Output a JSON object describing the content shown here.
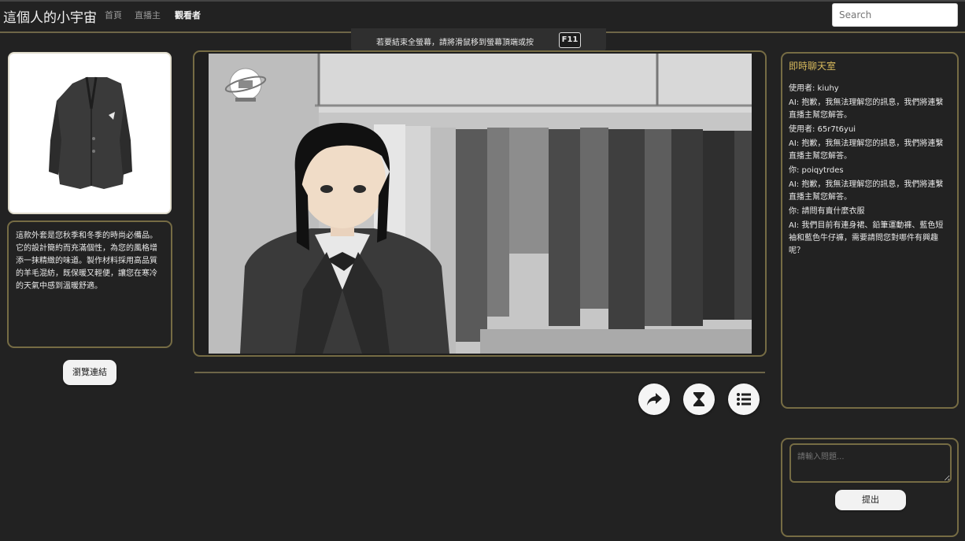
{
  "navbar": {
    "brand": "這個人的小宇宙",
    "links": [
      "首頁",
      "直播主",
      "觀看者"
    ],
    "search_placeholder": "Search"
  },
  "notice": {
    "text": "若要結束全螢幕，請將滑鼠移到螢幕頂端或按",
    "key": "F11"
  },
  "product": {
    "description": "這款外套是您秋季和冬季的時尚必備品。它的設計簡約而充滿個性，為您的風格增添一抹精緻的味道。製作材料採用高品質的羊毛混紡，既保暖又輕便，讓您在寒冷的天氣中感到溫暖舒適。",
    "browse_button": "瀏覽連結",
    "icon": "jacket-image"
  },
  "stage": {
    "logo_icon": "planet-icon",
    "actions": [
      "share-icon",
      "hourglass-icon",
      "list-icon"
    ]
  },
  "chat": {
    "title": "即時聊天室",
    "messages": [
      "使用者: kiuhy",
      "AI: 抱歉，我無法理解您的訊息，我們將連繫直播主幫您解答。",
      "使用者: 65r7t6yui",
      "AI: 抱歉，我無法理解您的訊息，我們將連繫直播主幫您解答。",
      "你: poiqytrdes",
      "AI: 抱歉，我無法理解您的訊息，我們將連繫直播主幫您解答。",
      "你: 請問有賣什麼衣服",
      "AI: 我們目前有連身裙、鉛筆運動褲、藍色短袖和藍色牛仔褲，需要請問您對哪件有興趣呢？"
    ],
    "input_placeholder": "請輸入問題...",
    "send_button": "提出"
  },
  "colors": {
    "background": "#222222",
    "accent_gold": "#766c44",
    "chat_title": "#d7b95d"
  }
}
